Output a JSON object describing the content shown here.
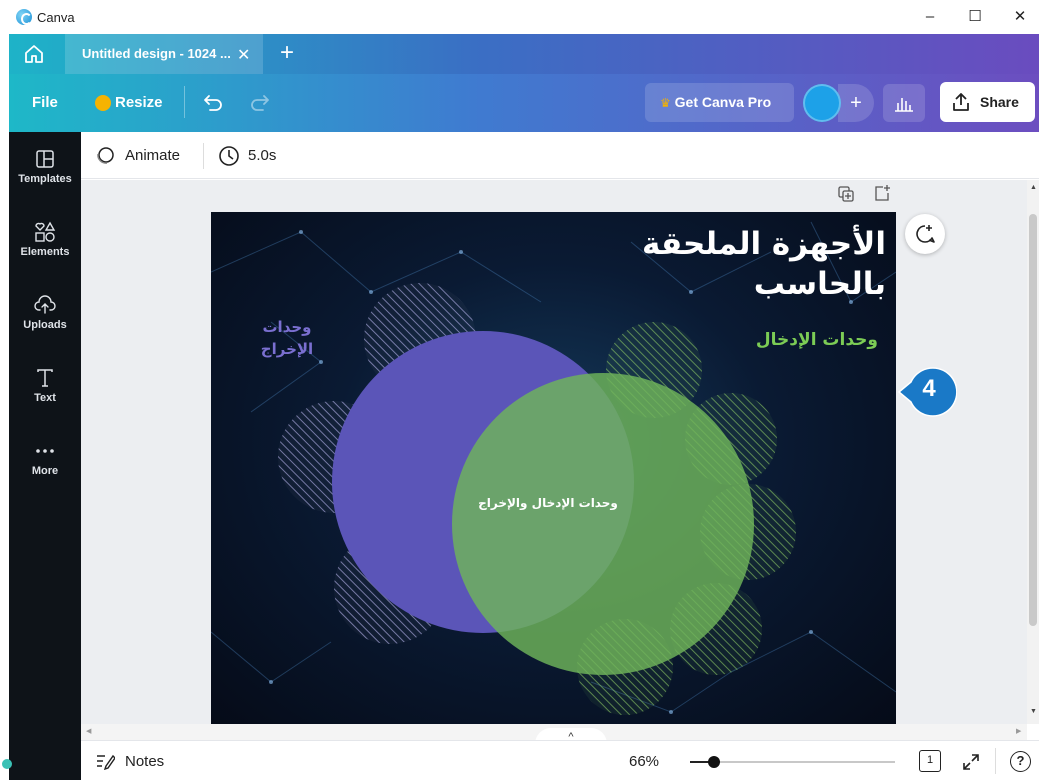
{
  "window": {
    "app_name": "Canva",
    "minimize": "–",
    "maximize": "☐",
    "close": "✕"
  },
  "tabs": {
    "active_title": "Untitled design - 1024 ...",
    "close": "✕",
    "add": "+"
  },
  "toolbar": {
    "file": "File",
    "resize": "Resize",
    "get_pro": "Get Canva Pro",
    "avatar_add": "+",
    "share": "Share"
  },
  "sidebar": {
    "items": [
      {
        "label": "Templates",
        "icon": "templates-icon"
      },
      {
        "label": "Elements",
        "icon": "elements-icon"
      },
      {
        "label": "Uploads",
        "icon": "uploads-icon"
      },
      {
        "label": "Text",
        "icon": "text-icon"
      },
      {
        "label": "More",
        "icon": "more-icon"
      }
    ]
  },
  "context_bar": {
    "animate": "Animate",
    "duration": "5.0s"
  },
  "slide": {
    "title_line1": "الأجهزة الملحقة",
    "title_line2": "بالحاسب",
    "input_label": "وحدات الإدخال",
    "output_label_line1": "وحدات",
    "output_label_line2": "الإخراج",
    "center_label": "وحدات الإدخال والإخراج",
    "colors": {
      "purple": "#5b55b8",
      "green": "#6fb55a",
      "title": "#ffffff",
      "input_text": "#7ccc55",
      "output_text": "#7a6fd0"
    }
  },
  "callout": {
    "number": "4",
    "color": "#1a79c7"
  },
  "bottom_bar": {
    "notes": "Notes",
    "zoom": "66%",
    "page": "1"
  },
  "colors": {
    "accent_teal": "#1eb3c8",
    "accent_purple": "#6a4cbf",
    "sidebar": "#0e1318"
  }
}
